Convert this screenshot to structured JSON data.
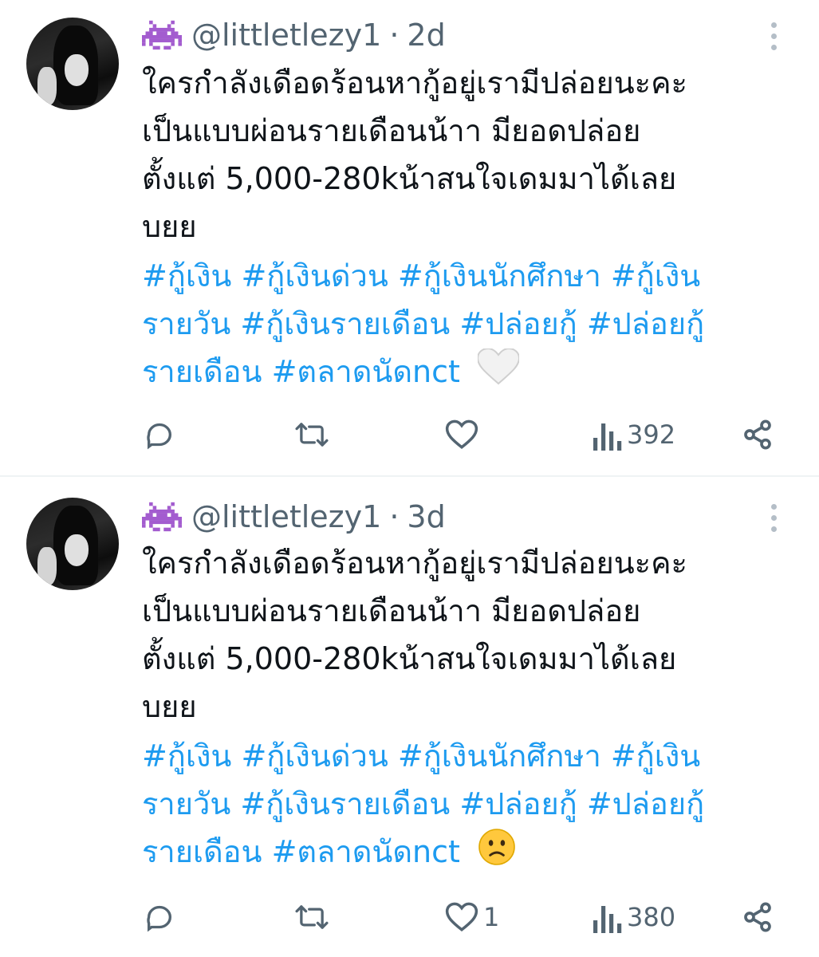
{
  "tweets": [
    {
      "handle": "@littletlezy1",
      "separator": "·",
      "time": "2d",
      "text_lines": [
        "ใครกำลังเดือดร้อนหากู้อยู่เรามีปล่อยนะคะ",
        "เป็นแบบผ่อนรายเดือนน้าา มียอดปล่อย",
        "ตั้งแต่ 5,000-280kน้าสนใจเดมมาได้เลย",
        "บยย"
      ],
      "tag_lines": [
        [
          "#กู้เงิน",
          "#กู้เงินด่วน",
          "#กู้เงินนักศึกษา",
          "#กู้เงิน"
        ],
        [
          "รายวัน",
          "#กู้เงินรายเดือน",
          "#ปล่อยกู้",
          " #ปล่อยกู้"
        ],
        [
          "รายเดือน",
          "#ตลาดนัดnct"
        ]
      ],
      "end_emoji": "white-heart",
      "reply_count": "",
      "retweet_count": "",
      "like_count": "",
      "view_count": "392"
    },
    {
      "handle": "@littletlezy1",
      "separator": "·",
      "time": "3d",
      "text_lines": [
        "ใครกำลังเดือดร้อนหากู้อยู่เรามีปล่อยนะคะ",
        "เป็นแบบผ่อนรายเดือนน้าา มียอดปล่อย",
        "ตั้งแต่ 5,000-280kน้าสนใจเดมมาได้เลย",
        "บยย"
      ],
      "tag_lines": [
        [
          "#กู้เงิน",
          "#กู้เงินด่วน",
          "#กู้เงินนักศึกษา",
          "#กู้เงิน"
        ],
        [
          "รายวัน",
          "#กู้เงินรายเดือน",
          "#ปล่อยกู้",
          " #ปล่อยกู้"
        ],
        [
          "รายเดือน",
          "#ตลาดนัดnct"
        ]
      ],
      "end_emoji": "slightly-frowning-face",
      "reply_count": "",
      "retweet_count": "",
      "like_count": "1",
      "view_count": "380"
    }
  ],
  "colors": {
    "text": "#0f1419",
    "muted": "#536471",
    "link": "#1d9bf0",
    "divider": "#eff3f4",
    "emoji_purple": "#a35ccf"
  },
  "icons": {
    "header_emoji": "alien-monster-icon",
    "reply": "reply-icon",
    "retweet": "retweet-icon",
    "like": "like-icon",
    "views": "views-icon",
    "share": "share-icon",
    "more": "more-icon"
  }
}
